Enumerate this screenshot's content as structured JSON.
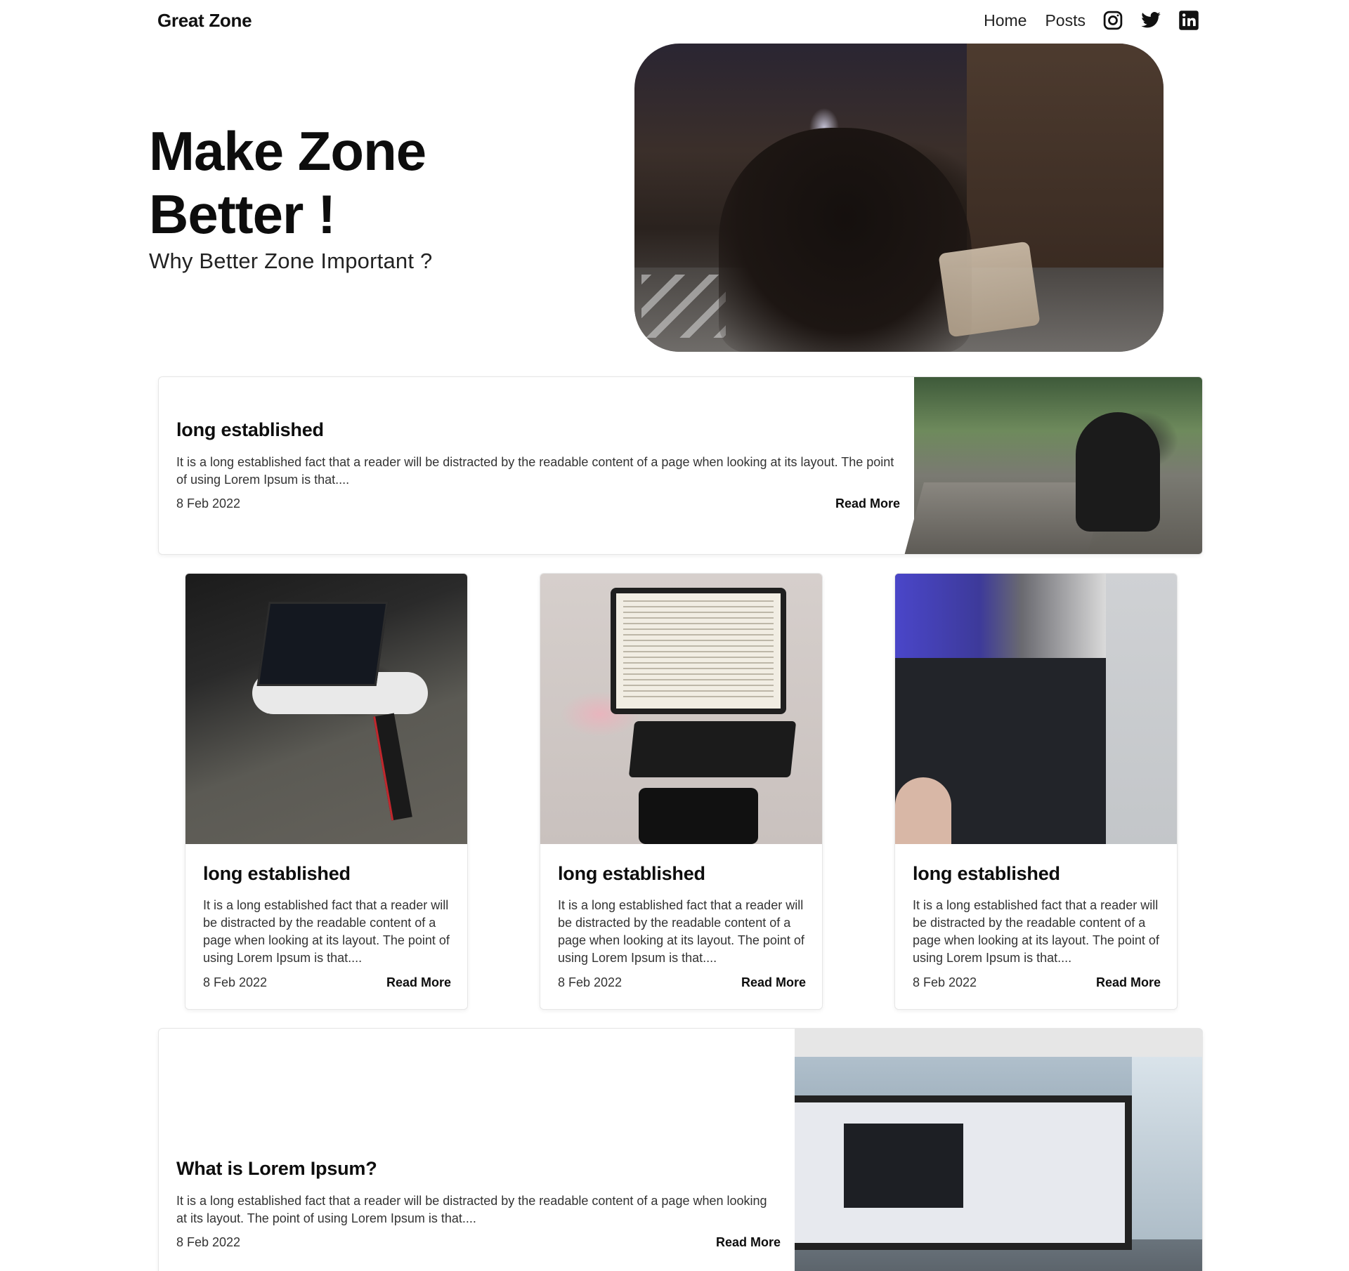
{
  "header": {
    "brand": "Great Zone",
    "nav": [
      {
        "label": "Home"
      },
      {
        "label": "Posts"
      }
    ],
    "social": [
      {
        "icon": "instagram-icon"
      },
      {
        "icon": "twitter-icon"
      },
      {
        "icon": "linkedin-icon"
      }
    ]
  },
  "hero": {
    "title": "Make Zone Better !",
    "subtitle": "Why Better Zone Important ?"
  },
  "featured_top": {
    "title": "long established",
    "excerpt": "It is a long established fact that a reader will be distracted by the readable content of a page when looking at its layout. The point of using Lorem Ipsum is that....",
    "date": "8 Feb 2022",
    "read_more": "Read More"
  },
  "grid": [
    {
      "title": "long established",
      "excerpt": "It is a long established fact that a reader will be distracted by the readable content of a page when looking at its layout. The point of using Lorem Ipsum is that....",
      "date": "8 Feb 2022",
      "read_more": "Read More"
    },
    {
      "title": "long established",
      "excerpt": "It is a long established fact that a reader will be distracted by the readable content of a page when looking at its layout. The point of using Lorem Ipsum is that....",
      "date": "8 Feb 2022",
      "read_more": "Read More"
    },
    {
      "title": "long established",
      "excerpt": "It is a long established fact that a reader will be distracted by the readable content of a page when looking at its layout. The point of using Lorem Ipsum is that....",
      "date": "8 Feb 2022",
      "read_more": "Read More"
    }
  ],
  "featured_bottom": {
    "title": "What is Lorem Ipsum?",
    "excerpt": "It is a long established fact that a reader will be distracted by the readable content of a page when looking at its layout. The point of using Lorem Ipsum is that....",
    "date": "8 Feb 2022",
    "read_more": "Read More"
  }
}
